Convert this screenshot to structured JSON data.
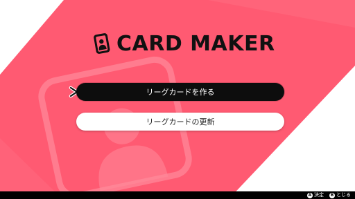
{
  "app": {
    "title": "CARD MAKER"
  },
  "menu": {
    "items": [
      {
        "label": "リーグカードを作る",
        "selected": true
      },
      {
        "label": "リーグカードの更新",
        "selected": false
      }
    ]
  },
  "footer": {
    "hints": [
      {
        "key": "A",
        "label": "決定"
      },
      {
        "key": "B",
        "label": "とじる"
      }
    ]
  },
  "colors": {
    "background_band": "#ff5a72",
    "background_band_light": "#ff7a8e",
    "background_white": "#ffffff",
    "selected_button": "#0d0d0d",
    "text_dark": "#111111"
  },
  "icons": {
    "title": "card-profile-icon",
    "cursor": "chevron-right-icon",
    "background": "card-profile-watermark-icon"
  }
}
